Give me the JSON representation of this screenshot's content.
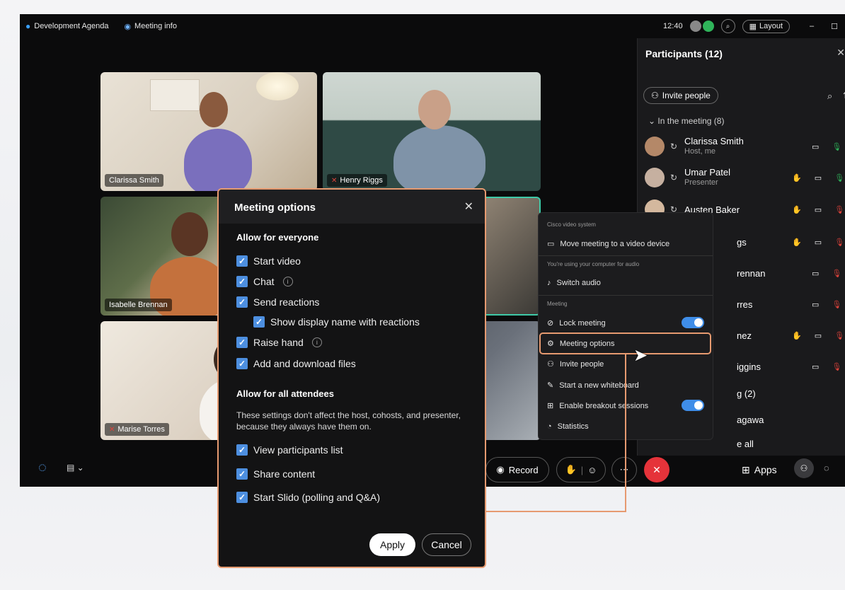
{
  "titlebar": {
    "app_title": "Development Agenda",
    "meeting_info": "Meeting info",
    "time": "12:40",
    "layout_label": "Layout"
  },
  "tiles": [
    {
      "name": "Clarissa Smith",
      "muted": false
    },
    {
      "name": "Henry Riggs",
      "muted": true
    },
    {
      "name": "Isabelle Brennan",
      "muted": false
    },
    {
      "name": "Marise Torres",
      "muted": true
    }
  ],
  "participants": {
    "title": "Participants (12)",
    "invite_label": "Invite people",
    "in_meeting_label": "In the meeting (8)",
    "rows": [
      {
        "name": "Clarissa Smith",
        "role": "Host, me"
      },
      {
        "name": "Umar Patel",
        "role": "Presenter"
      },
      {
        "name": "Austen Baker",
        "role": ""
      },
      {
        "name": "gs",
        "role": ""
      },
      {
        "name": "rennan",
        "role": ""
      },
      {
        "name": "rres",
        "role": ""
      },
      {
        "name": "nez",
        "role": ""
      },
      {
        "name": "iggins",
        "role": ""
      },
      {
        "name": "g (2)",
        "role": ""
      },
      {
        "name": "agawa",
        "role": ""
      },
      {
        "name": "e all",
        "role": ""
      }
    ]
  },
  "menu": {
    "cap_video": "Cisco video system",
    "move_video": "Move meeting to a video device",
    "cap_audio": "You're using your computer for audio",
    "switch_audio": "Switch audio",
    "cap_meeting": "Meeting",
    "lock_meeting": "Lock meeting",
    "meeting_options": "Meeting options",
    "invite_people": "Invite people",
    "whiteboard": "Start a new whiteboard",
    "breakout": "Enable breakout sessions",
    "statistics": "Statistics"
  },
  "bottom": {
    "record": "Record",
    "apps": "Apps"
  },
  "dialog": {
    "title": "Meeting options",
    "section_everyone": "Allow for everyone",
    "start_video": "Start video",
    "chat": "Chat",
    "send_reactions": "Send reactions",
    "show_display_name": "Show display name with reactions",
    "raise_hand": "Raise hand",
    "add_files": "Add and download files",
    "section_attendees": "Allow for all attendees",
    "note": "These settings don't affect the host, cohosts, and presenter, because they always have them on.",
    "view_participants": "View participants list",
    "share_content": "Share content",
    "start_slido": "Start Slido (polling and Q&A)",
    "apply": "Apply",
    "cancel": "Cancel"
  },
  "colors": {
    "accent": "#4d8fe0",
    "highlight": "#e69a70",
    "end_call": "#e5333a",
    "mic_on": "#2fb45a",
    "mic_off": "#e0433b"
  }
}
